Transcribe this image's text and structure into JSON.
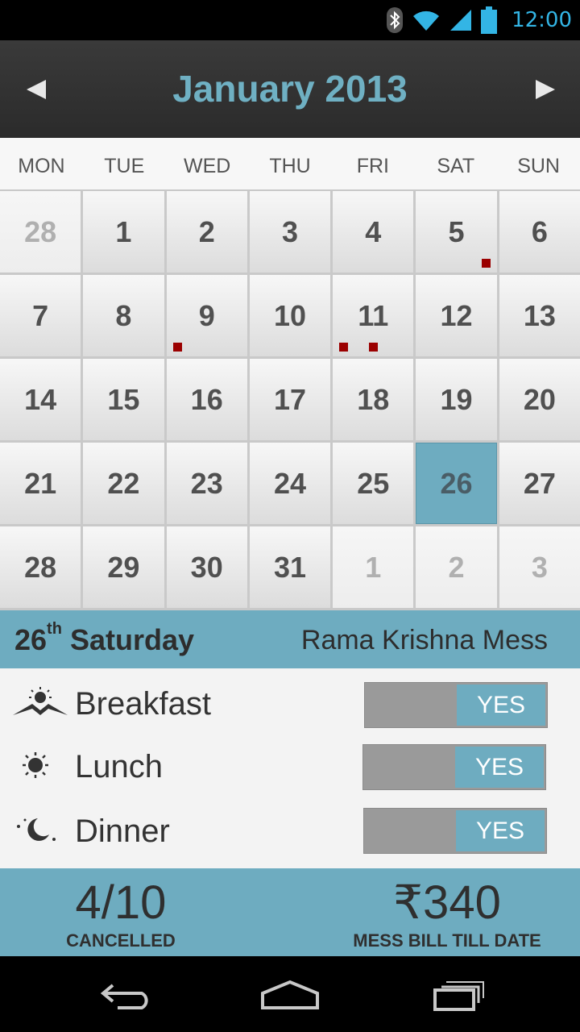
{
  "status_bar": {
    "time": "12:00",
    "icons": [
      "bluetooth-icon",
      "wifi-icon",
      "signal-icon",
      "battery-icon"
    ]
  },
  "header": {
    "title": "January 2013",
    "prev_icon": "chevron-left-icon",
    "next_icon": "chevron-right-icon"
  },
  "weekdays": [
    "MON",
    "TUE",
    "WED",
    "THU",
    "FRI",
    "SAT",
    "SUN"
  ],
  "calendar": {
    "days": [
      "28",
      "1",
      "2",
      "3",
      "4",
      "5",
      "6",
      "7",
      "8",
      "9",
      "10",
      "11",
      "12",
      "13",
      "14",
      "15",
      "16",
      "17",
      "18",
      "19",
      "20",
      "21",
      "22",
      "23",
      "24",
      "25",
      "26",
      "27",
      "28",
      "29",
      "30",
      "31",
      "1",
      "2",
      "3"
    ],
    "muted_days_note": "first cell and last three cells are adjacent-month days",
    "selected_day": "26",
    "marked_days": {
      "5": 1,
      "9": 1,
      "11": 2
    }
  },
  "info": {
    "day_num": "26",
    "day_suffix": "th",
    "day_name": "Saturday",
    "mess_name": "Rama Krishna Mess"
  },
  "meals": [
    {
      "name": "Breakfast",
      "icon": "sunrise-icon",
      "status": "YES"
    },
    {
      "name": "Lunch",
      "icon": "sun-icon",
      "status": "YES"
    },
    {
      "name": "Dinner",
      "icon": "moon-icon",
      "status": "YES"
    }
  ],
  "stats": {
    "cancelled_value": "4/10",
    "cancelled_label": "CANCELLED",
    "bill_value": "₹340",
    "bill_label": "MESS BILL TILL DATE"
  },
  "colors": {
    "accent": "#6eacc0",
    "title": "#6fb0c3",
    "marker": "#9b0000",
    "statusbar_icons": "#33b5e5"
  },
  "navbar": [
    "back-icon",
    "home-icon",
    "recent-apps-icon"
  ]
}
